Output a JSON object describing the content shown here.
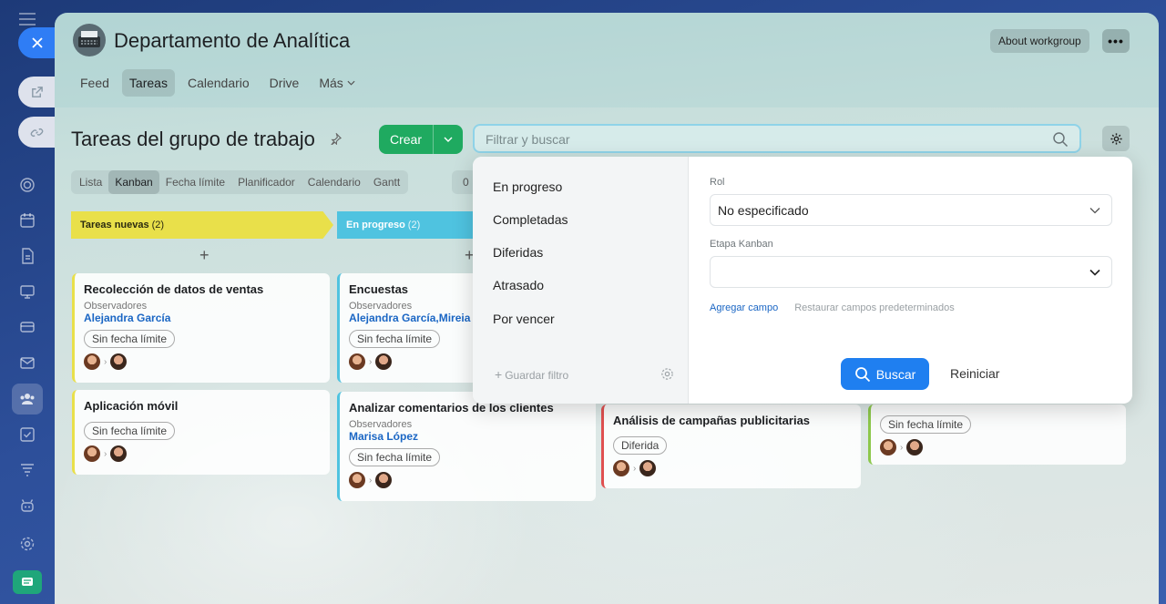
{
  "header": {
    "group_title": "Departamento de Analítica",
    "about_label": "About workgroup",
    "more_label": "•••",
    "nav": [
      "Feed",
      "Tareas",
      "Calendario",
      "Drive",
      "Más"
    ]
  },
  "toolbar": {
    "page_title": "Tareas del grupo de trabajo",
    "create_label": "Crear",
    "search_placeholder": "Filtrar y buscar"
  },
  "views": [
    "Lista",
    "Kanban",
    "Fecha límite",
    "Planificador",
    "Calendario",
    "Gantt"
  ],
  "views_extra": "0",
  "kanban": {
    "columns": [
      {
        "title": "Tareas nuevas",
        "count": "(2)"
      },
      {
        "title": "En progreso",
        "count": "(2)"
      }
    ],
    "cards": [
      {
        "title": "Recolección de datos de ventas",
        "obs": "Observadores",
        "person": "Alejandra García",
        "chip": "Sin fecha límite"
      },
      {
        "title": "Aplicación móvil",
        "chip": "Sin fecha límite"
      },
      {
        "title": "Encuestas",
        "obs": "Observadores",
        "person": "Alejandra García,Mireia M",
        "chip": "Sin fecha límite"
      },
      {
        "title": "Analizar comentarios de los clientes",
        "obs": "Observadores",
        "person": "Marisa López",
        "chip": "Sin fecha límite"
      },
      {
        "title": "Análisis de campañas publicitarias",
        "chip": "Diferida"
      },
      {
        "chip": "Sin fecha límite"
      }
    ]
  },
  "filter": {
    "presets": [
      "En progreso",
      "Completadas",
      "Diferidas",
      "Atrasado",
      "Por vencer"
    ],
    "save_filter": "Guardar filtro",
    "fields": [
      {
        "label": "Rol",
        "value": "No especificado"
      },
      {
        "label": "Etapa Kanban",
        "value": ""
      }
    ],
    "add_field": "Agregar campo",
    "restore_fields": "Restaurar campos predeterminados",
    "search_button": "Buscar",
    "reset_button": "Reiniciar"
  },
  "colors": {
    "accent": "#1f7ff0",
    "create": "#1faa60",
    "col_new": "#e9e04a",
    "col_progress": "#4fc3e0",
    "link": "#1a66c4"
  }
}
